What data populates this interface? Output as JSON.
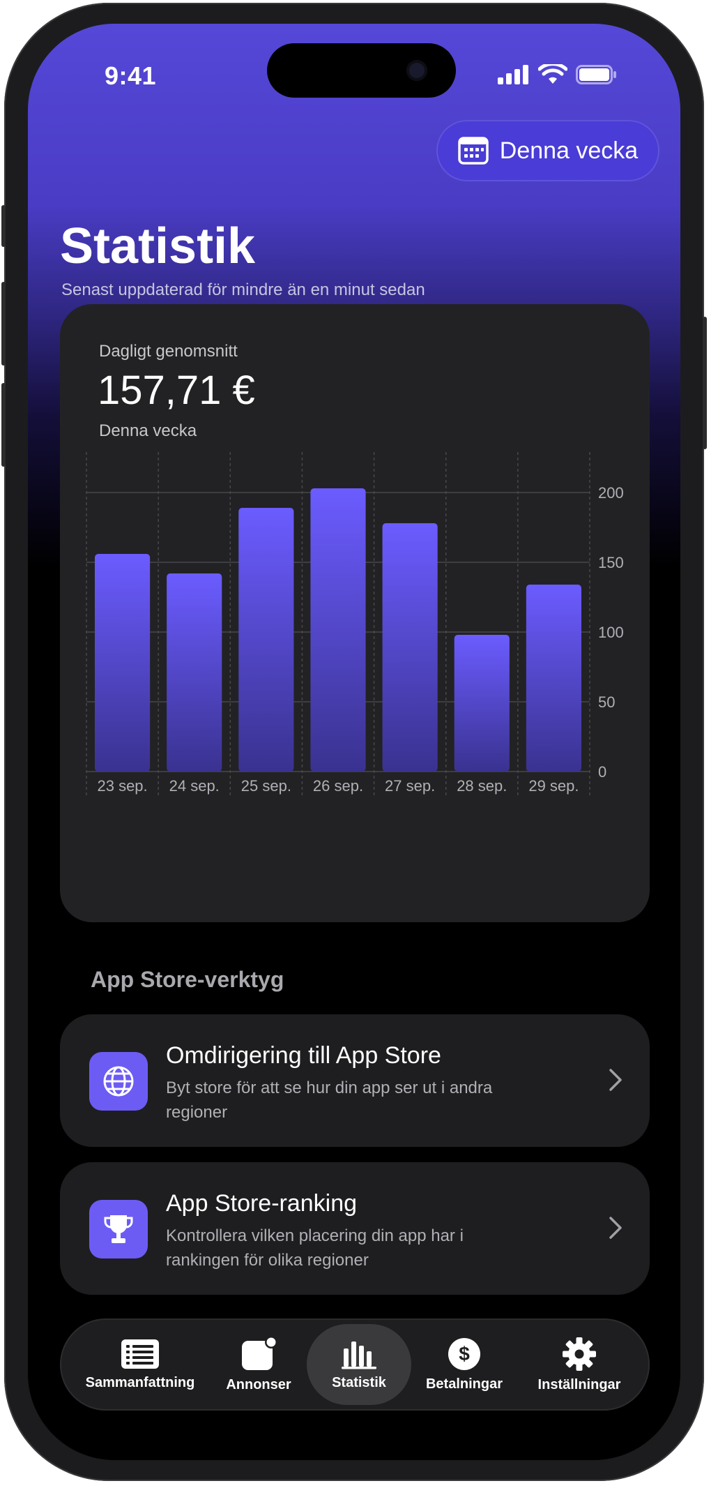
{
  "status_bar": {
    "time": "9:41"
  },
  "header": {
    "week_chip_label": "Denna vecka",
    "title": "Statistik",
    "subtitle": "Senast uppdaterad för mindre än en minut sedan"
  },
  "summary": {
    "label": "Dagligt genomsnitt",
    "value": "157,71 €",
    "period": "Denna vecka"
  },
  "chart_data": {
    "type": "bar",
    "categories": [
      "23 sep.",
      "24 sep.",
      "25 sep.",
      "26 sep.",
      "27 sep.",
      "28 sep.",
      "29 sep."
    ],
    "values": [
      156,
      142,
      189,
      203,
      178,
      98,
      134
    ],
    "ylim": [
      0,
      200
    ],
    "yticks": [
      0,
      50,
      100,
      150,
      200
    ],
    "ytick_labels": [
      "0",
      "50",
      "100",
      "150",
      "200"
    ],
    "y_axis_side": "right",
    "grid": true,
    "bar_color_top": "#6b5cff",
    "bar_color_bottom": "#3a3290"
  },
  "tools": {
    "section_title": "App Store-verktyg",
    "items": [
      {
        "icon": "globe-icon",
        "title": "Omdirigering till App Store",
        "description": "Byt store för att se hur din app ser ut i andra regioner"
      },
      {
        "icon": "trophy-icon",
        "title": "App Store-ranking",
        "description": "Kontrollera vilken placering din app har i rankingen för olika regioner"
      }
    ]
  },
  "tabbar": {
    "items": [
      {
        "icon": "list-icon",
        "label": "Sammanfattning",
        "active": false
      },
      {
        "icon": "ads-icon",
        "label": "Annonser",
        "active": false
      },
      {
        "icon": "bar-chart-icon",
        "label": "Statistik",
        "active": true
      },
      {
        "icon": "dollar-icon",
        "label": "Betalningar",
        "active": false
      },
      {
        "icon": "gear-icon",
        "label": "Inställningar",
        "active": false
      }
    ]
  },
  "colors": {
    "accent": "#6c5cf4",
    "card": "#222224",
    "background": "#000000"
  }
}
